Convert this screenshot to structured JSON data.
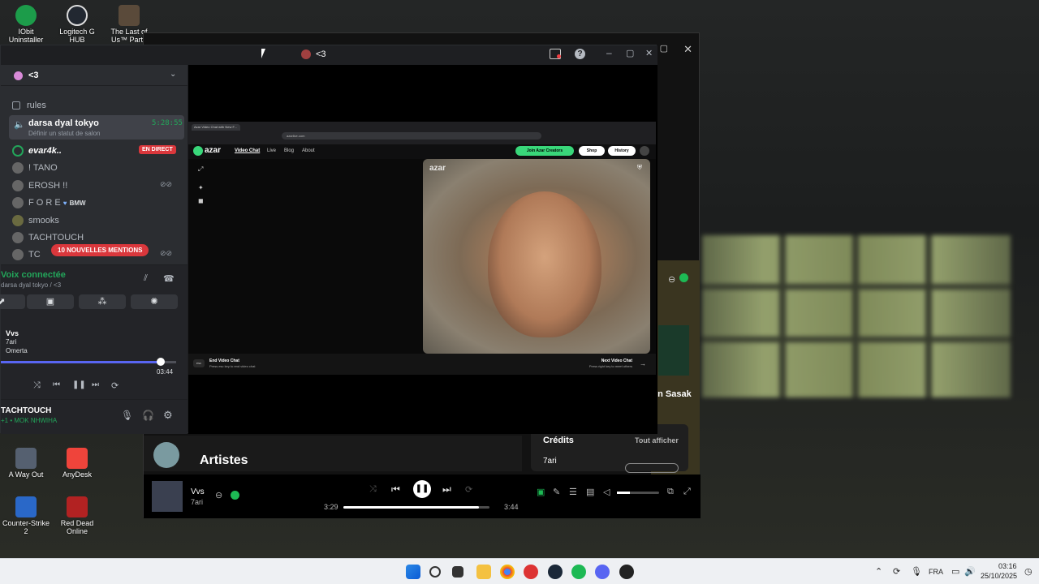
{
  "desktop": {
    "icons": [
      {
        "label": "IObit Uninstaller",
        "color": "#1c9c4a"
      },
      {
        "label": "Logitech G HUB",
        "color": "#222831"
      },
      {
        "label": "The Last of Us™ Part I",
        "color": "#5a4a3a"
      },
      {
        "label": "A Way Out",
        "color": "#556070"
      },
      {
        "label": "AnyDesk",
        "color": "#ef443b"
      },
      {
        "label": "Counter-Strike 2",
        "color": "#2a68c8"
      },
      {
        "label": "Red Dead Online",
        "color": "#b22222"
      }
    ]
  },
  "discord": {
    "title": "<3",
    "server_name": "<3",
    "channels": {
      "rules": "rules",
      "voice_channel": "darsa dyal tokyo",
      "voice_timer": "5:28:55",
      "voice_status": "Définir un statut de salon",
      "live_badge": "EN DIRECT",
      "mentions_badge": "10 NOUVELLES MENTIONS"
    },
    "members": [
      {
        "name": "evar4k..",
        "live": true
      },
      {
        "name": "! TANO"
      },
      {
        "name": "EROSH !!"
      },
      {
        "name": "F O R E",
        "tag": "BMW"
      },
      {
        "name": "smooks"
      },
      {
        "name": "TACHTOUCH"
      },
      {
        "name": "TC"
      }
    ],
    "voice_panel": {
      "status": "Voix connectée",
      "location": "darsa dyal tokyo / <3"
    },
    "now_playing": {
      "track": "Vvs",
      "artist": "7ari",
      "album": "Omerta",
      "duration": "03:44",
      "progress": 0.9
    },
    "user": {
      "name": "TACHTOUCH",
      "status": "+1 • MOK NHWIHA"
    }
  },
  "azar": {
    "tab_title": "Azar Video Chat with New F...",
    "url": "azarlive.com",
    "brand": "azar",
    "nav": [
      "Video Chat",
      "Live",
      "Blog",
      "About"
    ],
    "join_button": "Join Azar Creators",
    "shop_button": "Shop",
    "history_button": "History",
    "video_watermark": "azar",
    "end_chat_title": "End Video Chat",
    "end_chat_hint": "Press esc key to end video chat",
    "esc_key": "esc",
    "next_chat_title": "Next Video Chat",
    "next_chat_hint": "Press right key to meet others"
  },
  "spotify": {
    "artists_heading": "Artistes",
    "credits_heading": "Crédits",
    "show_all": "Tout afficher",
    "credit_artist": "7ari",
    "side_label": "en Sasak",
    "track": "Vvs",
    "artist": "7ari",
    "elapsed": "3:29",
    "total": "3:44",
    "progress": 0.93,
    "volume": 0.3
  },
  "taskbar": {
    "lang": "FRA",
    "time": "03:16",
    "date": "25/10/2025"
  }
}
